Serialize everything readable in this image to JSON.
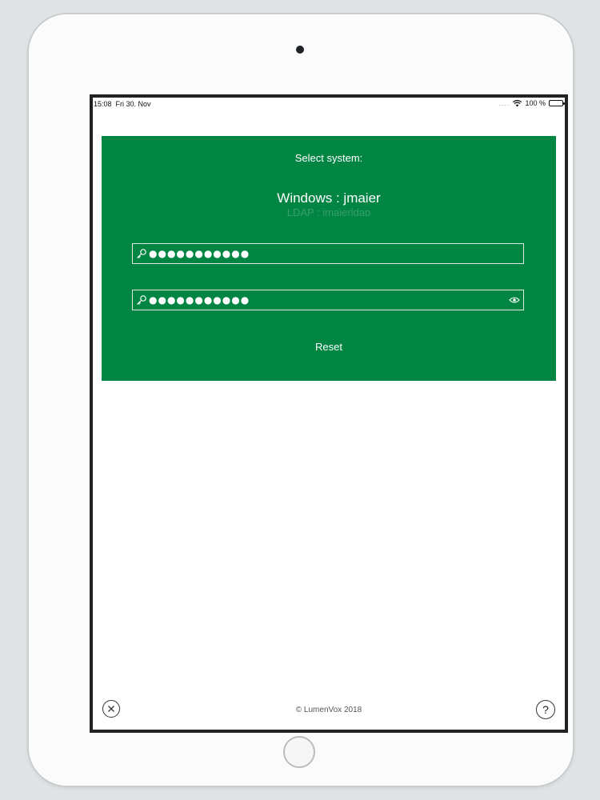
{
  "status_bar": {
    "time": "15:08",
    "date": "Fri 30. Nov",
    "signal_dots": "....",
    "battery": "100 %"
  },
  "login": {
    "select_label": "Select system:",
    "systems": [
      {
        "label": "Windows : jmaier",
        "selected": true
      },
      {
        "label": "LDAP : jmaierldap",
        "selected": false
      }
    ],
    "fields": {
      "password_1": {
        "value": "●●●●●●●●●●●",
        "icon": "key-icon"
      },
      "password_2": {
        "value": "●●●●●●●●●●●",
        "icon": "key-icon",
        "reveal_icon": "eye-icon"
      }
    },
    "reset_label": "Reset",
    "accent_color": "#008542"
  },
  "footer": {
    "copyright": "© LumenVox 2018",
    "help_label": "?",
    "close_icon": "close-circle-icon",
    "help_icon": "help-circle-icon"
  }
}
